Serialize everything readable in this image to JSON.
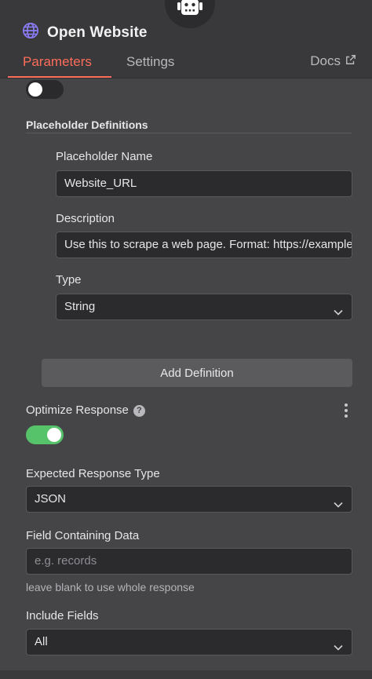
{
  "node": {
    "title": "Open Website"
  },
  "tabs": [
    {
      "label": "Parameters",
      "active": true
    },
    {
      "label": "Settings",
      "active": false
    }
  ],
  "docs": {
    "label": "Docs"
  },
  "top_toggle": {
    "on": false
  },
  "placeholder_definitions": {
    "title": "Placeholder Definitions",
    "name_label": "Placeholder Name",
    "name_value": "Website_URL",
    "description_label": "Description",
    "description_value": "Use this to scrape a web page. Format: https://example",
    "type_label": "Type",
    "type_value": "String",
    "add_button": "Add Definition"
  },
  "optimize_response": {
    "label": "Optimize Response",
    "help": "?",
    "on": true
  },
  "expected_response_type": {
    "label": "Expected Response Type",
    "value": "JSON"
  },
  "field_containing_data": {
    "label": "Field Containing Data",
    "placeholder": "e.g. records",
    "hint": "leave blank to use whole response"
  },
  "include_fields": {
    "label": "Include Fields",
    "value": "All"
  },
  "colors": {
    "accent": "#ff6d5a",
    "toggle_on": "#56c26a"
  },
  "icons": [
    "robot-icon",
    "globe-icon",
    "external-link-icon",
    "help-icon",
    "chevron-down-icon",
    "kebab-icon"
  ]
}
